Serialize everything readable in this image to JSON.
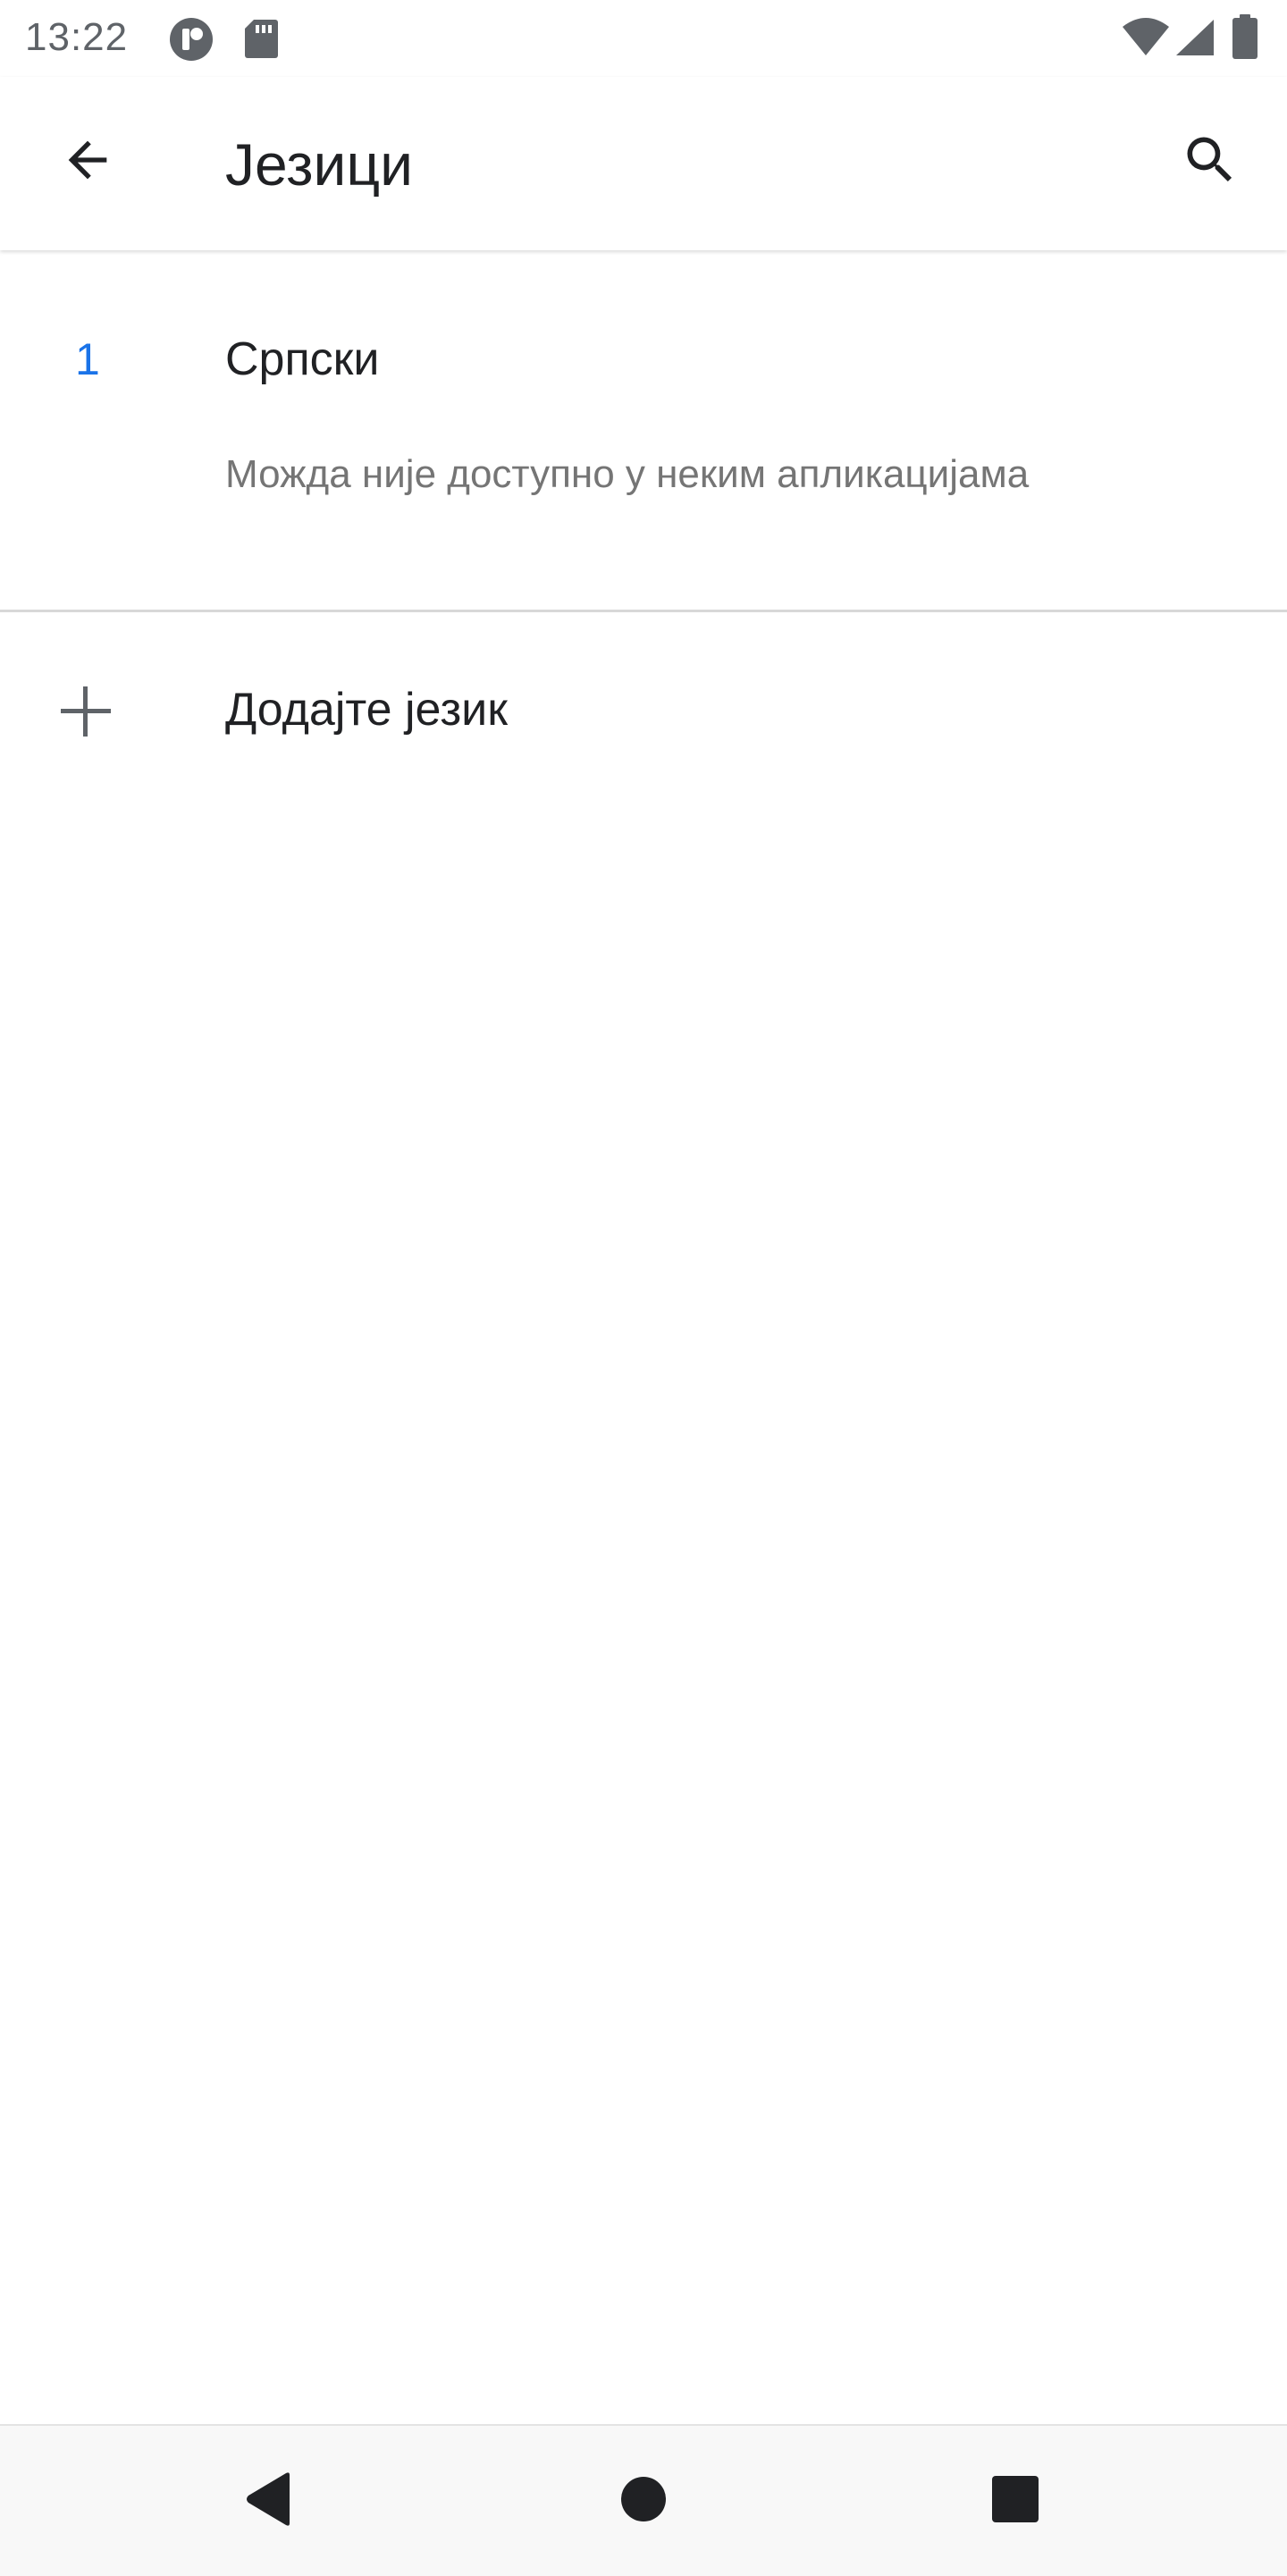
{
  "status_bar": {
    "time": "13:22",
    "icons": [
      "app-notification-icon",
      "sd-card-icon",
      "wifi-icon",
      "cell-signal-icon",
      "battery-icon"
    ]
  },
  "app_bar": {
    "title": "Језици",
    "back_icon": "arrow-back-icon",
    "search_icon": "search-icon"
  },
  "languages": [
    {
      "number": "1",
      "name": "Српски",
      "note": "Можда није доступно у неким апликацијама"
    }
  ],
  "add_language": {
    "label": "Додајте језик",
    "icon": "plus-icon"
  },
  "nav_bar": {
    "icons": [
      "back-triangle-icon",
      "home-circle-icon",
      "recents-square-icon"
    ]
  },
  "colors": {
    "accent": "#1a73e8",
    "text_primary": "#202124",
    "text_secondary": "#757575",
    "icon_gray": "#5f6368"
  }
}
